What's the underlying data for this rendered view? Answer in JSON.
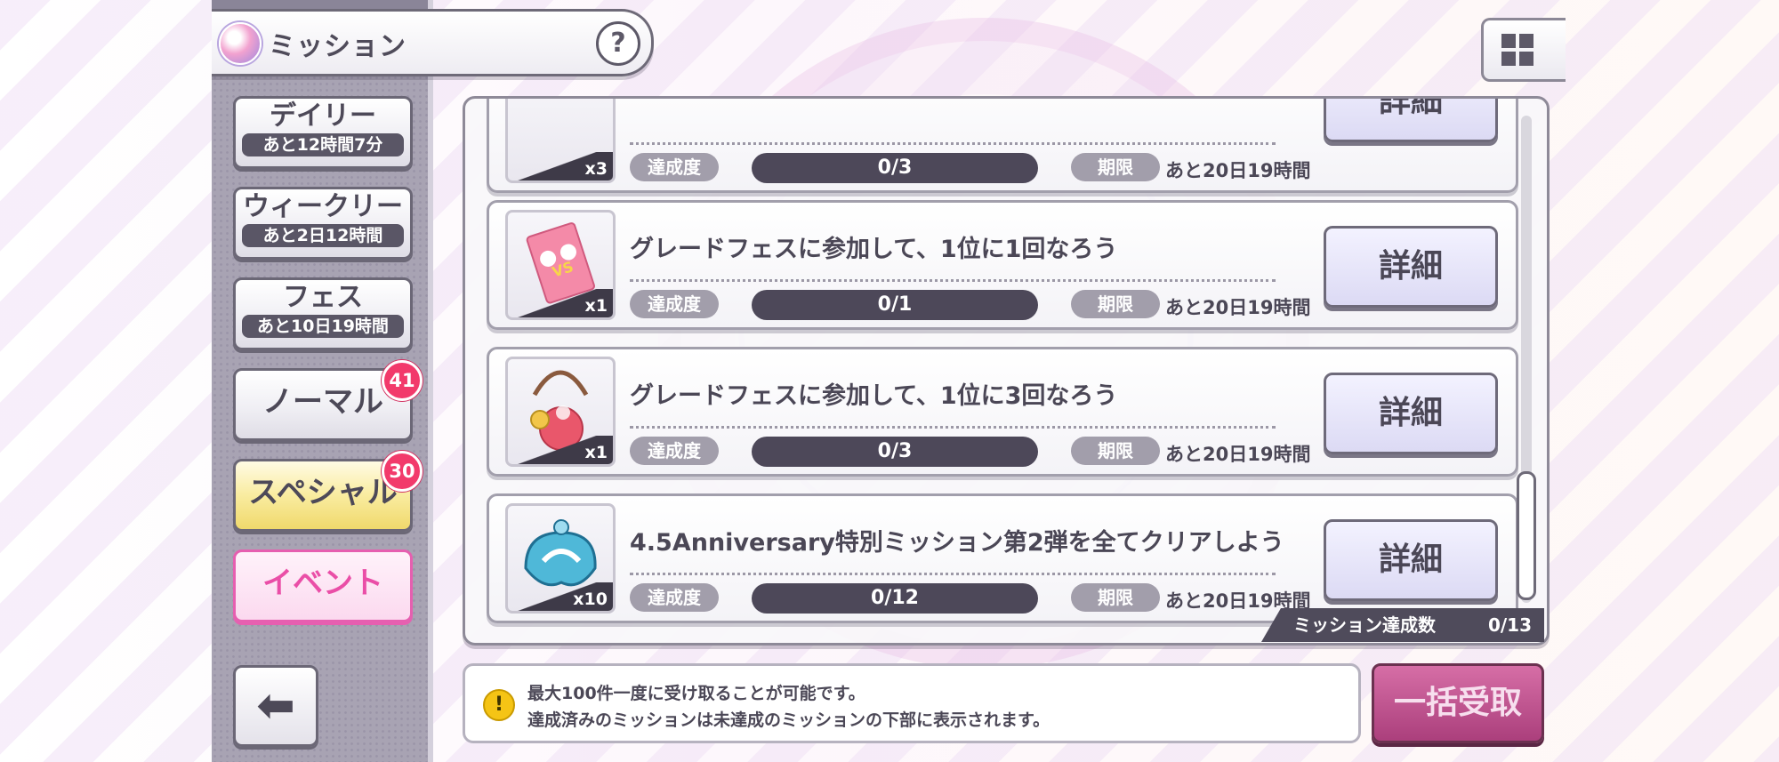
{
  "header": {
    "title": "ミッション",
    "help_label": "?"
  },
  "sidebar": {
    "tabs": [
      {
        "label": "デイリー",
        "sub": "あと12時間7分"
      },
      {
        "label": "ウィークリー",
        "sub": "あと2日12時間"
      },
      {
        "label": "フェス",
        "sub": "あと10日19時間"
      },
      {
        "label": "ノーマル",
        "badge": "41"
      },
      {
        "label": "スペシャル",
        "badge": "30"
      },
      {
        "label": "イベント"
      }
    ],
    "back_label": "⬅"
  },
  "missions": [
    {
      "title": "",
      "qty": "x3",
      "progress_label": "達成度",
      "progress": "0/3",
      "deadline_label": "期限",
      "deadline": "あと20日19時間",
      "detail_label": "詳細"
    },
    {
      "title": "グレードフェスに参加して、1位に1回なろう",
      "qty": "x1",
      "progress_label": "達成度",
      "progress": "0/1",
      "deadline_label": "期限",
      "deadline": "あと20日19時間",
      "detail_label": "詳細"
    },
    {
      "title": "グレードフェスに参加して、1位に3回なろう",
      "qty": "x1",
      "progress_label": "達成度",
      "progress": "0/3",
      "deadline_label": "期限",
      "deadline": "あと20日19時間",
      "detail_label": "詳細"
    },
    {
      "title": "4.5Anniversary特別ミッション第2弾を全てクリアしよう",
      "qty": "x10",
      "progress_label": "達成度",
      "progress": "0/12",
      "deadline_label": "期限",
      "deadline": "あと20日19時間",
      "detail_label": "詳細"
    }
  ],
  "mission_count": {
    "label": "ミッション達成数",
    "value": "0/13"
  },
  "info": {
    "line1": "最大100件一度に受け取ることが可能です。",
    "line2": "達成済みのミッションは未達成のミッションの下部に表示されます。"
  },
  "bulk_receive_label": "一括受取",
  "colors": {
    "accent_pink": "#ea4ea7",
    "badge_red": "#f23a6b",
    "dark_panel": "#4d4859"
  }
}
